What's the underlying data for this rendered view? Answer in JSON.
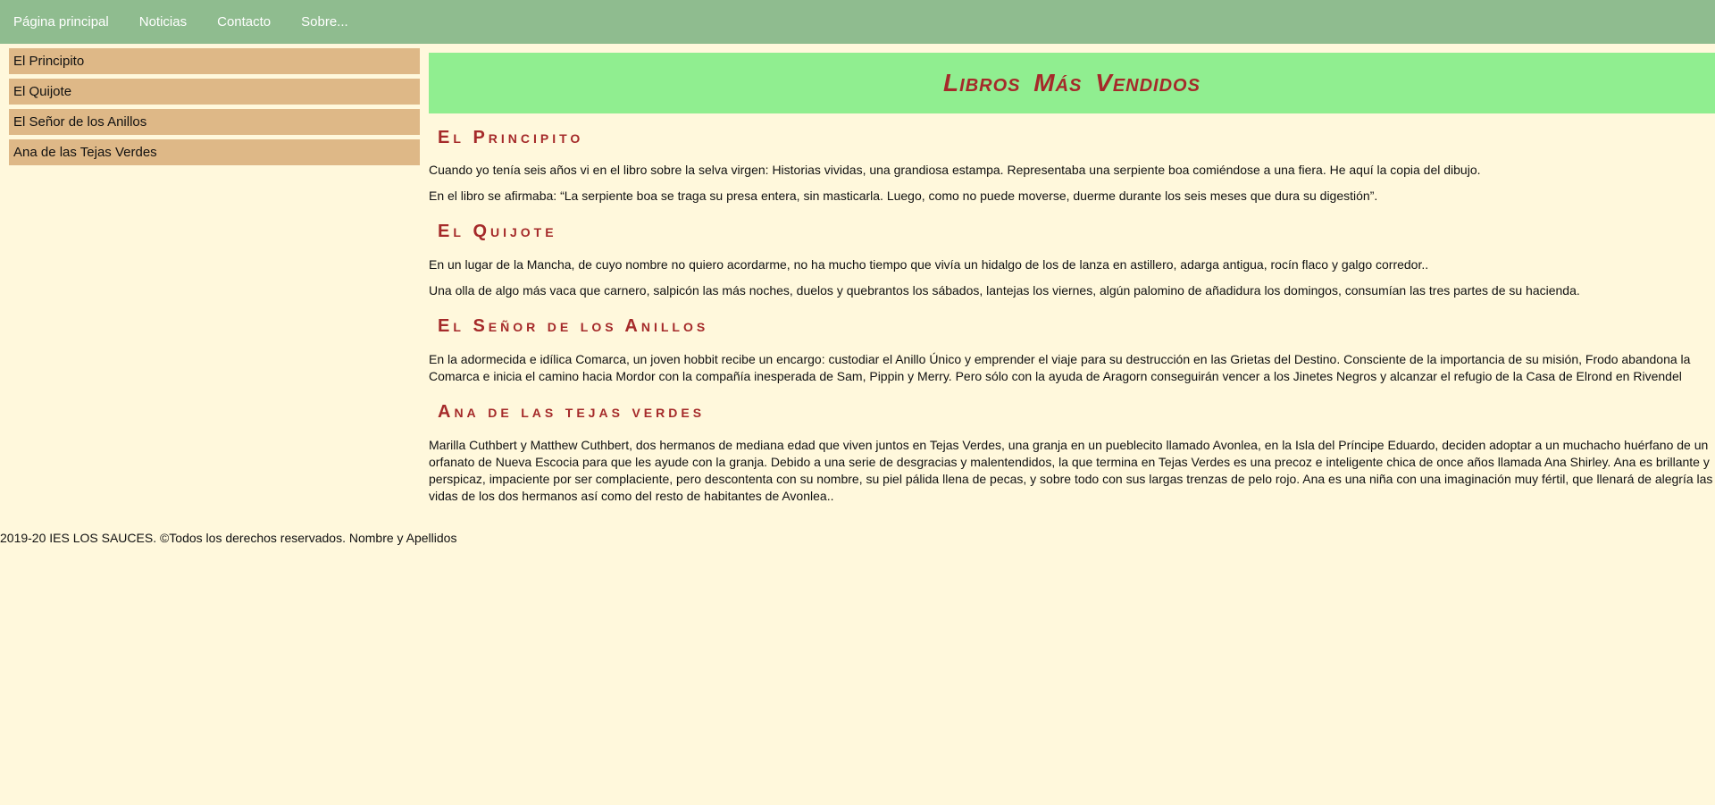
{
  "nav": {
    "items": [
      "Página principal",
      "Noticias",
      "Contacto",
      "Sobre..."
    ]
  },
  "sidebar": {
    "items": [
      "El Principito",
      "El Quijote",
      "El Señor de los Anillos",
      "Ana de las Tejas Verdes"
    ]
  },
  "main": {
    "title": "Libros Más Vendidos",
    "sections": [
      {
        "heading": "El Principito",
        "paragraphs": [
          "Cuando yo tenía seis años vi en el libro sobre la selva virgen: Historias vividas, una grandiosa estampa. Representaba una serpiente boa comiéndose a una fiera. He aquí la copia del dibujo.",
          "En el libro se afirmaba: “La serpiente boa se traga su presa entera, sin masticarla. Luego, como no puede moverse, duerme durante los seis meses que dura su digestión”."
        ]
      },
      {
        "heading": "El Quijote",
        "paragraphs": [
          "En un lugar de la Mancha, de cuyo nombre no quiero acordarme, no ha mucho tiempo que vivía un hidalgo de los de lanza en astillero, adarga antigua, rocín flaco y galgo corredor..",
          "Una olla de algo más vaca que carnero, salpicón las más noches, duelos y quebrantos los sábados, lantejas los viernes, algún palomino de añadidura los domingos, consumían las tres partes de su hacienda."
        ]
      },
      {
        "heading": "El Señor de los Anillos",
        "paragraphs": [
          "En la adormecida e idílica Comarca, un joven hobbit recibe un encargo: custodiar el Anillo Único y emprender el viaje para su destrucción en las Grietas del Destino. Consciente de la importancia de su misión, Frodo abandona la Comarca e inicia el camino hacia Mordor con la compañía inesperada de Sam, Pippin y Merry. Pero sólo con la ayuda de Aragorn conseguirán vencer a los Jinetes Negros y alcanzar el refugio de la Casa de Elrond en Rivendel"
        ]
      },
      {
        "heading": "Ana de las tejas verdes",
        "paragraphs": [
          "Marilla Cuthbert y Matthew Cuthbert, dos hermanos de mediana edad que viven juntos en Tejas Verdes, una granja en un pueblecito llamado Avonlea, en la Isla del Príncipe Eduardo, deciden adoptar a un muchacho huérfano de un orfanato de Nueva Escocia para que les ayude con la granja. Debido a una serie de desgracias y malentendidos, la que termina en Tejas Verdes es una precoz e inteligente chica de once años llamada Ana Shirley. Ana es brillante y perspicaz, impaciente por ser complaciente, pero descontenta con su nombre, su piel pálida llena de pecas, y sobre todo con sus largas trenzas de pelo rojo. Ana es una niña con una imaginación muy fértil, que llenará de alegría las vidas de los dos hermanos así como del resto de habitantes de Avonlea.."
        ]
      }
    ]
  },
  "footer": {
    "text": "2019-20 IES LOS SAUCES. ©Todos los derechos reservados. Nombre y Apellidos"
  },
  "colors": {
    "nav_bg": "#8fbc8f",
    "sidebar_item_bg": "#deb887",
    "banner_bg": "#90ee90",
    "heading_color": "#a52a2a",
    "page_bg": "#fff8dc"
  }
}
